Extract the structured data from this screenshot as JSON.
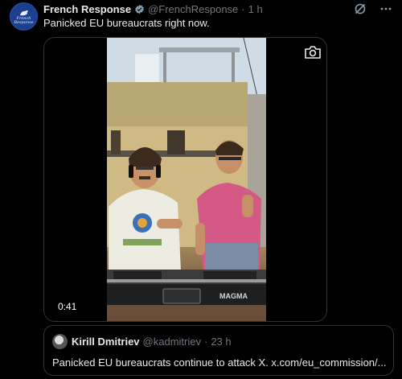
{
  "post": {
    "author_name": "French Response",
    "author_handle": "@FrenchResponse",
    "separator": "·",
    "time": "1 h",
    "text": "Panicked EU bureaucrats right now.",
    "avatar_text_line1": "French",
    "avatar_text_line2": "Response"
  },
  "media": {
    "duration": "0:41",
    "brand_label": "MAGMA",
    "camera_icon": "camera-icon"
  },
  "quote": {
    "author_name": "Kirill Dmitriev",
    "author_handle": "@kadmitriev",
    "separator": "·",
    "time": "23 h",
    "text": "Panicked EU bureaucrats continue to attack X. x.com/eu_commission/..."
  },
  "icons": {
    "grok": "grok-icon",
    "more": "more-icon",
    "verified": "verified-badge-icon"
  },
  "colors": {
    "background": "#000000",
    "text": "#e7e9ea",
    "muted": "#71767b",
    "border": "#2f3336",
    "verified": "#829aab"
  }
}
